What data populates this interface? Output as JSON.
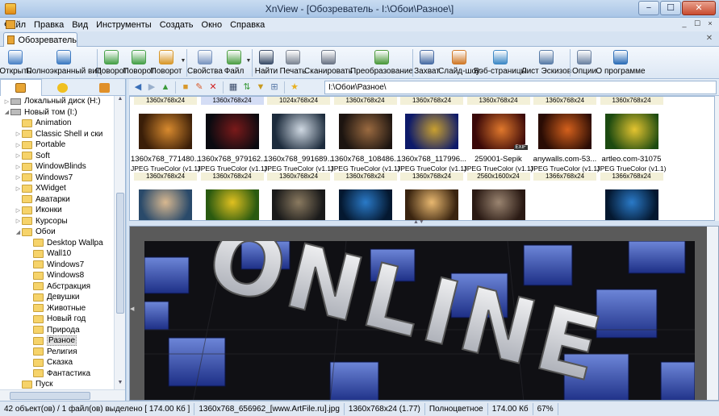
{
  "window": {
    "title": "XnView - [Обозреватель - I:\\Обои\\Разное\\]",
    "controls": [
      "−",
      "☐",
      "✕"
    ]
  },
  "menu": [
    "Файл",
    "Правка",
    "Вид",
    "Инструменты",
    "Создать",
    "Окно",
    "Справка"
  ],
  "menu_right": [
    "_",
    "☐",
    "×"
  ],
  "tab": {
    "label": "Обозреватель"
  },
  "toolbar": [
    {
      "label": "Открыть",
      "icon": "open-icon",
      "color": "#4d84c7"
    },
    {
      "label": "Полноэкранный вид",
      "icon": "fullscreen-icon",
      "color": "#3e7bc2"
    },
    {
      "label": "Поворот",
      "icon": "rotate-left-icon",
      "color": "#47a14a"
    },
    {
      "label": "Поворот",
      "icon": "rotate-right-icon",
      "color": "#47a14a"
    },
    {
      "label": "Поворот",
      "icon": "rotate-custom-icon",
      "color": "#d8982b"
    },
    {
      "label": "Свойства",
      "icon": "properties-icon",
      "color": "#7b96c0"
    },
    {
      "label": "Файл",
      "icon": "file-icon",
      "color": "#4fa047"
    },
    {
      "label": "Найти",
      "icon": "binoculars-icon",
      "color": "#3d4f6b"
    },
    {
      "label": "Печать",
      "icon": "print-icon",
      "color": "#7e8795"
    },
    {
      "label": "Сканировать",
      "icon": "scanner-icon",
      "color": "#6c7687"
    },
    {
      "label": "Преобразование",
      "icon": "convert-icon",
      "color": "#4d9a3e"
    },
    {
      "label": "Захват",
      "icon": "capture-icon",
      "color": "#4a6ea5"
    },
    {
      "label": "Слайд-шоу",
      "icon": "slideshow-icon",
      "color": "#d07a2a"
    },
    {
      "label": "Вэб-страницы",
      "icon": "web-icon",
      "color": "#3f89c6"
    },
    {
      "label": "Лист Эскизов",
      "icon": "contact-sheet-icon",
      "color": "#5a7da8"
    },
    {
      "label": "Опции",
      "icon": "options-icon",
      "color": "#6e84a3"
    },
    {
      "label": "О программе",
      "icon": "about-icon",
      "color": "#2f6fb8"
    }
  ],
  "tree": [
    {
      "label": "Локальный диск (H:)",
      "indent": 1,
      "kind": "drive",
      "exp": "+"
    },
    {
      "label": "Новый том (I:)",
      "indent": 1,
      "kind": "drive",
      "exp": "−"
    },
    {
      "label": "Animation",
      "indent": 2,
      "kind": "folder",
      "exp": ""
    },
    {
      "label": "Classic Shell и ски",
      "indent": 2,
      "kind": "folder",
      "exp": "+"
    },
    {
      "label": "Portable",
      "indent": 2,
      "kind": "folder",
      "exp": "+"
    },
    {
      "label": "Soft",
      "indent": 2,
      "kind": "folder",
      "exp": "+"
    },
    {
      "label": "WindowBlinds",
      "indent": 2,
      "kind": "folder",
      "exp": "+"
    },
    {
      "label": "Windows7",
      "indent": 2,
      "kind": "folder",
      "exp": "+"
    },
    {
      "label": "XWidget",
      "indent": 2,
      "kind": "folder",
      "exp": "+"
    },
    {
      "label": "Аватарки",
      "indent": 2,
      "kind": "folder",
      "exp": ""
    },
    {
      "label": "Иконки",
      "indent": 2,
      "kind": "folder",
      "exp": "+"
    },
    {
      "label": "Курсоры",
      "indent": 2,
      "kind": "folder",
      "exp": "+"
    },
    {
      "label": "Обои",
      "indent": 2,
      "kind": "folder",
      "exp": "−"
    },
    {
      "label": "Desktop Wallpa",
      "indent": 3,
      "kind": "folder",
      "exp": ""
    },
    {
      "label": "Wall10",
      "indent": 3,
      "kind": "folder",
      "exp": ""
    },
    {
      "label": "Windows7",
      "indent": 3,
      "kind": "folder",
      "exp": ""
    },
    {
      "label": "Windows8",
      "indent": 3,
      "kind": "folder",
      "exp": ""
    },
    {
      "label": "Абстракция",
      "indent": 3,
      "kind": "folder",
      "exp": ""
    },
    {
      "label": "Девушки",
      "indent": 3,
      "kind": "folder",
      "exp": ""
    },
    {
      "label": "Животные",
      "indent": 3,
      "kind": "folder",
      "exp": ""
    },
    {
      "label": "Новый год",
      "indent": 3,
      "kind": "folder",
      "exp": ""
    },
    {
      "label": "Природа",
      "indent": 3,
      "kind": "folder",
      "exp": ""
    },
    {
      "label": "Разное",
      "indent": 3,
      "kind": "folder",
      "exp": "",
      "selected": true
    },
    {
      "label": "Религия",
      "indent": 3,
      "kind": "folder",
      "exp": ""
    },
    {
      "label": "Сказка",
      "indent": 3,
      "kind": "folder",
      "exp": ""
    },
    {
      "label": "Фантастика",
      "indent": 3,
      "kind": "folder",
      "exp": ""
    },
    {
      "label": "Пуск",
      "indent": 2,
      "kind": "folder",
      "exp": ""
    }
  ],
  "address": "I:\\Обои\\Разное\\",
  "thumbs_row1": [
    {
      "top": "1360x768x24",
      "name": "1360x768_771480...",
      "fmt": "JPEG TrueColor (v1.1)",
      "dims": "1360x768x24",
      "c1": "#3a1e08",
      "c2": "#d88a2e",
      "selected": false
    },
    {
      "top": "1360x768x24",
      "name": "1360x768_979162...",
      "fmt": "JPEG TrueColor (v1.1)",
      "dims": "1360x768x24",
      "c1": "#0a0a10",
      "c2": "#7a1a1a",
      "selected": true
    },
    {
      "top": "1024x768x24",
      "name": "1360x768_991689...",
      "fmt": "JPEG TrueColor (v1.1)",
      "dims": "1360x768x24",
      "c1": "#1c2b3c",
      "c2": "#cfd8e2",
      "selected": false
    },
    {
      "top": "1360x768x24",
      "name": "1360x768_108486...",
      "fmt": "JPEG TrueColor (v1.1)",
      "dims": "1360x768x24",
      "c1": "#1c1410",
      "c2": "#9a6a40",
      "selected": false
    },
    {
      "top": "1360x768x24",
      "name": "1360x768_117996...",
      "fmt": "JPEG TrueColor (v1.1)",
      "dims": "1360x768x24",
      "c1": "#0d1a6a",
      "c2": "#c9a030",
      "selected": false
    },
    {
      "top": "1360x768x24",
      "name": "259001-Sepik",
      "fmt": "JPEG TrueColor (v1.1)",
      "dims": "2560x1600x24",
      "c1": "#3a0808",
      "c2": "#e0782c",
      "selected": false
    },
    {
      "top": "1360x768x24",
      "name": "anywalls.com-53...",
      "fmt": "JPEG TrueColor (v1.1)",
      "dims": "1366x768x24",
      "c1": "#2a0c04",
      "c2": "#d4601c",
      "selected": false
    },
    {
      "top": "1360x768x24",
      "name": "artleo.com-31075",
      "fmt": "JPEG TrueColor (v1.1)",
      "dims": "1366x768x24",
      "c1": "#1c4a10",
      "c2": "#e4c430",
      "selected": false
    }
  ],
  "thumbs_row2": [
    {
      "c1": "#2a4a6a",
      "c2": "#d8b890"
    },
    {
      "c1": "#2a5a10",
      "c2": "#e0c020"
    },
    {
      "c1": "#1a1a1a",
      "c2": "#8a7a60"
    },
    {
      "c1": "#041830",
      "c2": "#2a7ac8"
    },
    {
      "c1": "#3a2410",
      "c2": "#e8b870"
    },
    {
      "c1": "#2a1a14",
      "c2": "#9a8470"
    },
    {
      "c1": "#ffffff",
      "c2": "#ffffff"
    },
    {
      "c1": "#041830",
      "c2": "#2a7ac8"
    }
  ],
  "exif_badge": "EXIF",
  "preview": {
    "text": "ONLINE"
  },
  "status": [
    "42 объект(ов) / 1 файл(ов) выделено  [ 174.00 Кб ]",
    "1360x768_656962_[www.ArtFile.ru].jpg",
    "1360x768x24 (1.77)",
    "Полноцветное",
    "174.00 Кб",
    "67%"
  ]
}
